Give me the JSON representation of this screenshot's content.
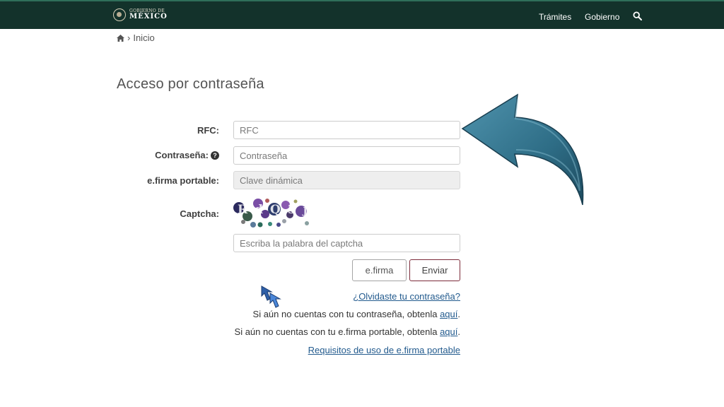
{
  "header": {
    "logo_small": "GOBIERNO DE",
    "logo_big": "MÉXICO",
    "nav": [
      "Trámites",
      "Gobierno"
    ],
    "search_icon": "search-icon"
  },
  "breadcrumb": {
    "home_icon": "home-icon",
    "separator": "›",
    "label": "Inicio"
  },
  "page_title": "Acceso por contraseña",
  "form": {
    "rfc_label": "RFC:",
    "rfc_placeholder": "RFC",
    "password_label": "Contraseña:",
    "password_placeholder": "Contraseña",
    "efirma_label": "e.firma portable:",
    "efirma_placeholder": "Clave dinámica",
    "captcha_label": "Captcha:",
    "captcha_text": "RdQ3j",
    "captcha_placeholder": "Escriba la palabra del captcha",
    "btn_efirma": "e.firma",
    "btn_enviar": "Enviar"
  },
  "links": {
    "forgot": "¿Olvidaste tu contraseña?",
    "no_password_text": "Si aún no cuentas con tu contraseña, obtenla ",
    "no_password_link": "aquí",
    "no_efirma_text": "Si aún no cuentas con tu e.firma portable, obtenla ",
    "no_efirma_link": "aquí",
    "period": ".",
    "requisitos": "Requisitos de uso de e.firma portable"
  },
  "colors": {
    "header_bg": "#13322b",
    "link": "#235b8e",
    "button_border": "#9d2449",
    "arrow": "#2e6d86"
  }
}
